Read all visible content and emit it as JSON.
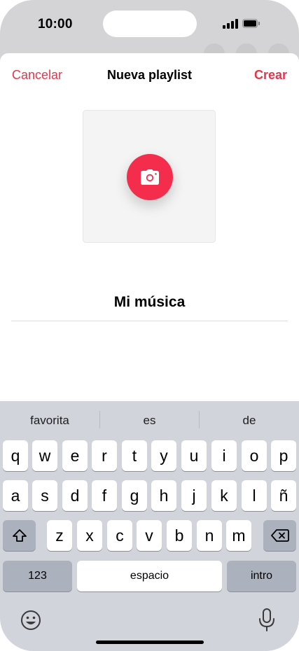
{
  "status_bar": {
    "time": "10:00"
  },
  "nav": {
    "cancel_label": "Cancelar",
    "title": "Nueva playlist",
    "create_label": "Crear"
  },
  "playlist": {
    "name": "Mi música"
  },
  "keyboard": {
    "suggestions": [
      "favorita",
      "es",
      "de"
    ],
    "row1": [
      "q",
      "w",
      "e",
      "r",
      "t",
      "y",
      "u",
      "i",
      "o",
      "p"
    ],
    "row2": [
      "a",
      "s",
      "d",
      "f",
      "g",
      "h",
      "j",
      "k",
      "l",
      "ñ"
    ],
    "row3": [
      "z",
      "x",
      "c",
      "v",
      "b",
      "n",
      "m"
    ],
    "numbers_label": "123",
    "space_label": "espacio",
    "return_label": "intro"
  },
  "colors": {
    "accent": "#e8344b",
    "camera_button": "#f52d4d",
    "keyboard_bg": "#d1d4db"
  }
}
